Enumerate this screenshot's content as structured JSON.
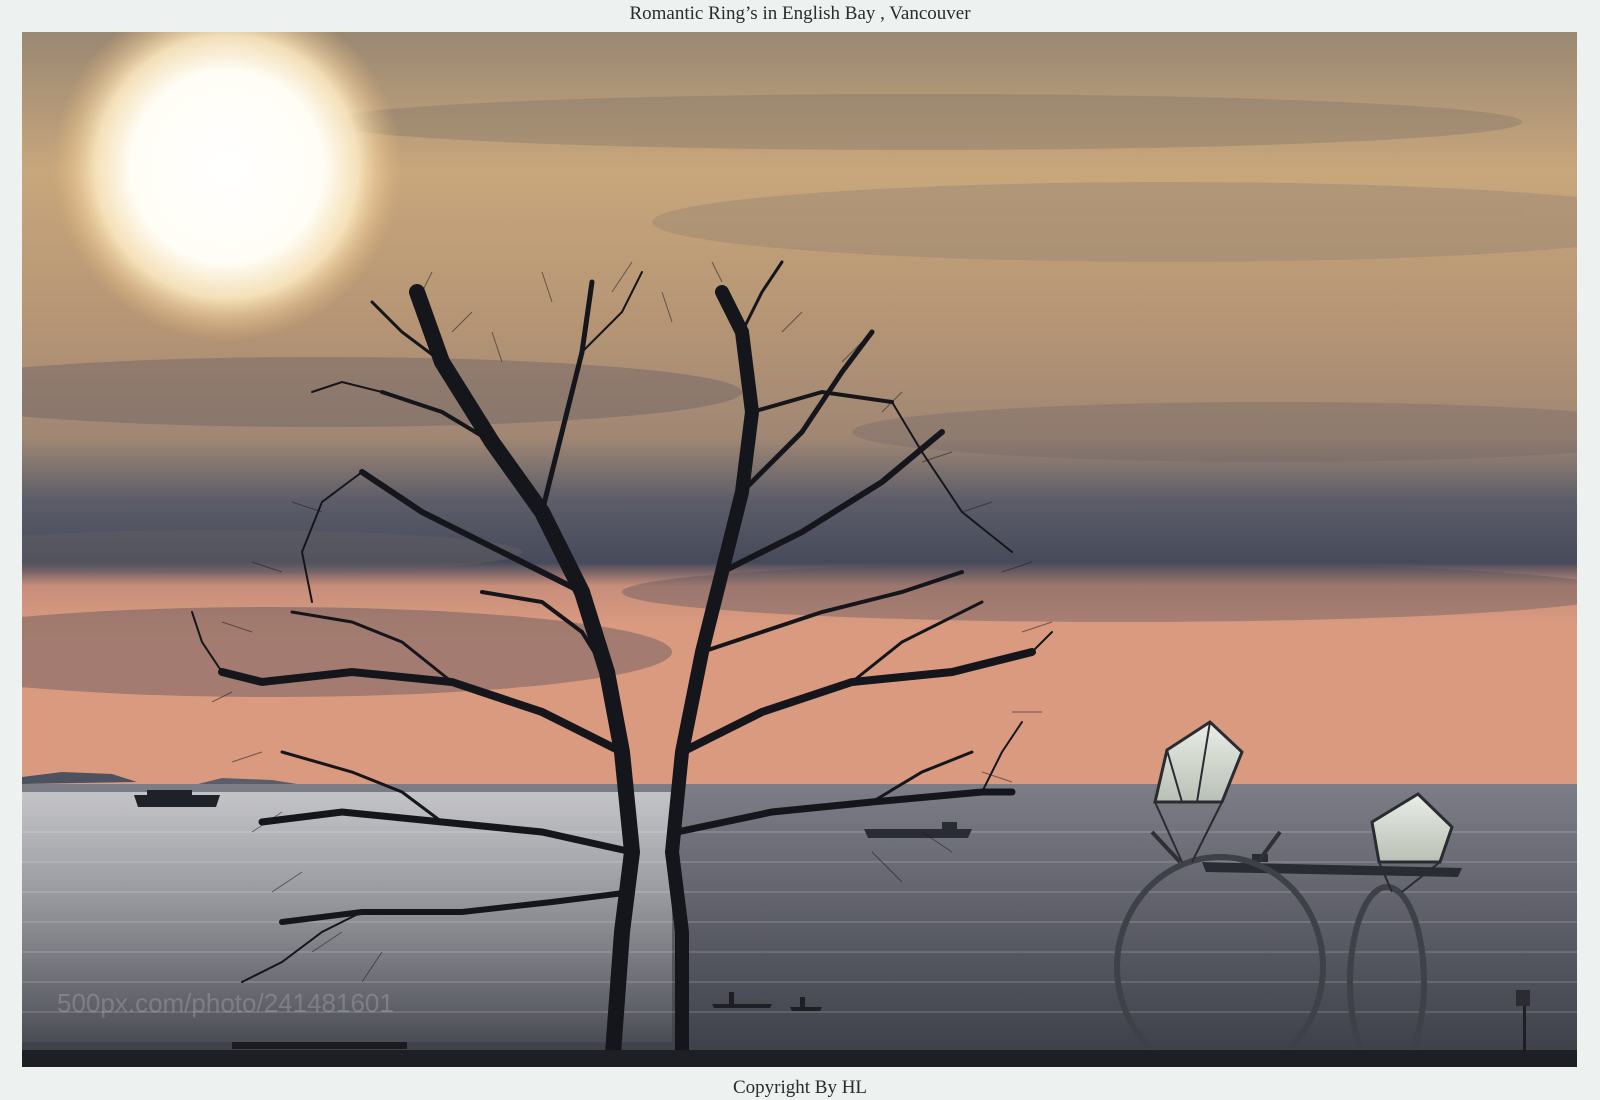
{
  "page": {
    "title": "Romantic Ring’s in English Bay , Vancouver",
    "copyright": "Copyright By HL",
    "background_color": "#edf2f1"
  },
  "photo": {
    "subject": "sunset-over-english-bay",
    "watermark_text": "500px.com/photo/241481601"
  }
}
